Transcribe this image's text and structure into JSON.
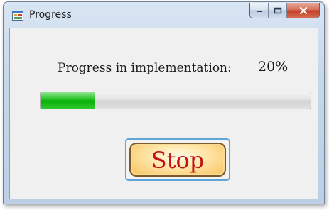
{
  "window": {
    "title": "Progress",
    "icon": "application-window-icon",
    "caption_buttons": [
      "minimize-icon",
      "maximize-icon",
      "close-icon"
    ]
  },
  "progress": {
    "label": "Progress in implementation:",
    "percent_text": "20%",
    "value": 0.2
  },
  "stop_button": {
    "label": "Stop"
  },
  "colors": {
    "progress_fill": "#06b006",
    "stop_text": "#c41414",
    "stop_face": "#ffe5a8",
    "focus_border": "#5fa6d6"
  }
}
